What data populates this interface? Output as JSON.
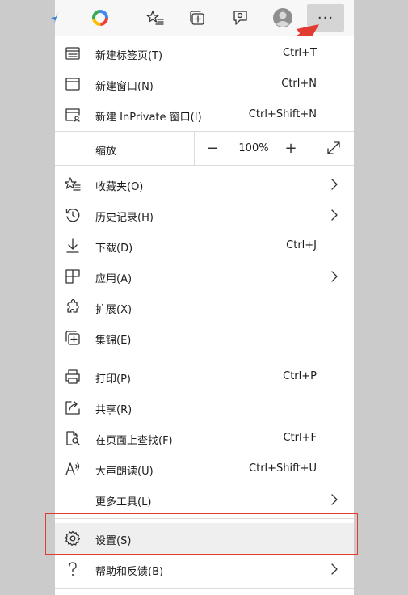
{
  "menu": {
    "new_tab": {
      "label": "新建标签页(T)",
      "shortcut": "Ctrl+T"
    },
    "new_window": {
      "label": "新建窗口(N)",
      "shortcut": "Ctrl+N"
    },
    "new_inprivate": {
      "label": "新建 InPrivate 窗口(I)",
      "shortcut": "Ctrl+Shift+N"
    },
    "zoom": {
      "label": "缩放",
      "minus": "−",
      "value": "100%",
      "plus": "+"
    },
    "favorites": {
      "label": "收藏夹(O)"
    },
    "history": {
      "label": "历史记录(H)"
    },
    "downloads": {
      "label": "下载(D)",
      "shortcut": "Ctrl+J"
    },
    "apps": {
      "label": "应用(A)"
    },
    "extensions": {
      "label": "扩展(X)"
    },
    "collections": {
      "label": "集锦(E)"
    },
    "print": {
      "label": "打印(P)",
      "shortcut": "Ctrl+P"
    },
    "share": {
      "label": "共享(R)"
    },
    "find": {
      "label": "在页面上查找(F)",
      "shortcut": "Ctrl+F"
    },
    "read_aloud": {
      "label": "大声朗读(U)",
      "shortcut": "Ctrl+Shift+U"
    },
    "more_tools": {
      "label": "更多工具(L)"
    },
    "settings": {
      "label": "设置(S)"
    },
    "help": {
      "label": "帮助和反馈(B)"
    }
  },
  "toolbar": {
    "more_label": "···"
  },
  "colors": {
    "annotation_red": "#e03c31",
    "menu_bg": "#ffffff",
    "hover_bg": "#efefef"
  }
}
